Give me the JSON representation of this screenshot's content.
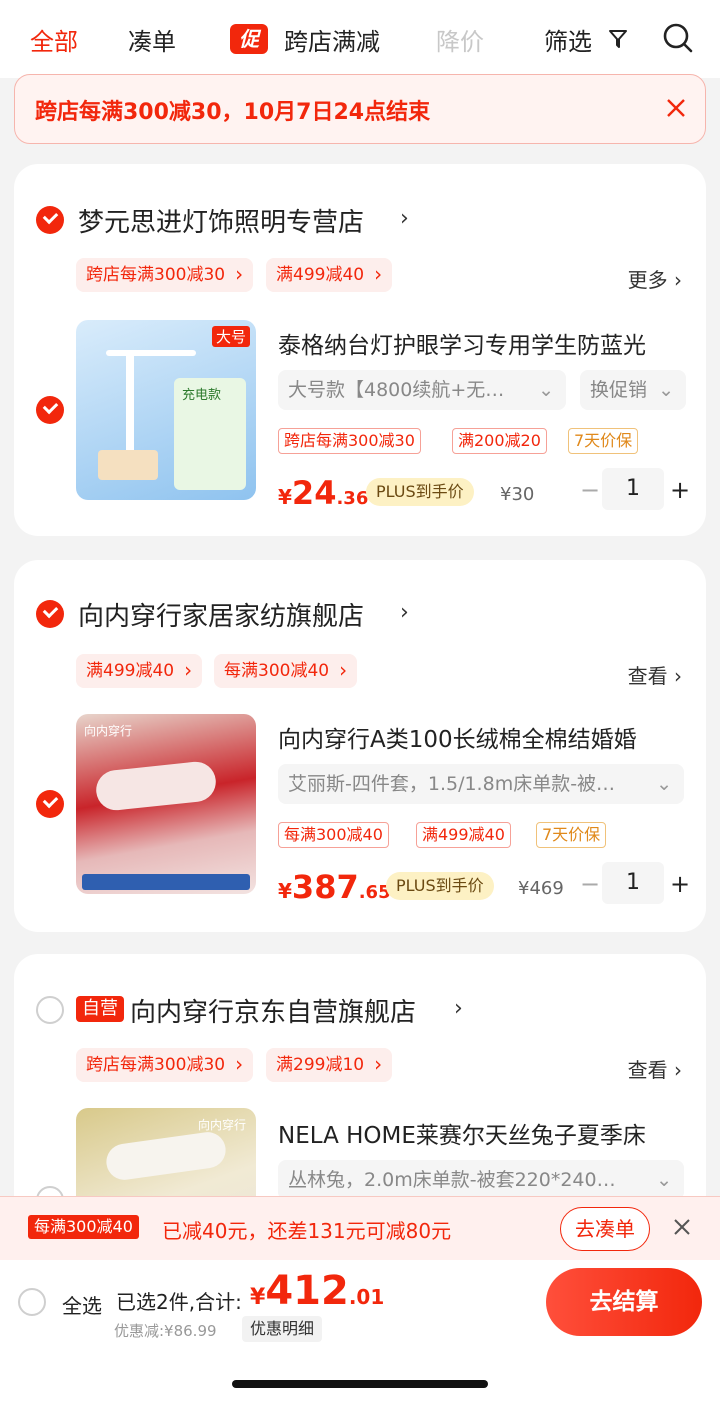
{
  "tabs": [
    {
      "label": "全部"
    },
    {
      "label": "凑单"
    },
    {
      "label": "跨店满减",
      "tag": "促"
    },
    {
      "label": "降价"
    },
    {
      "label": "筛选"
    }
  ],
  "notice": {
    "text": "跨店每满300减30，10月7日24点结束"
  },
  "stores": [
    {
      "name": "梦元思进灯饰照明专营店",
      "promos": [
        "跨店每满300减30",
        "满499减40"
      ],
      "more_label": "更多",
      "product": {
        "title": "泰格纳台灯护眼学习专用学生防蓝光",
        "spec": "大号款【4800续航+无…",
        "spec_extra": "换促销",
        "tags": [
          "跨店每满300减30",
          "满200减20",
          "7天价保"
        ],
        "price_int": "24",
        "price_dec": ".36",
        "plus_label": "PLUS到手价",
        "original_price": "¥30",
        "qty": "1",
        "thumb_label": "大号",
        "thumb_sub": "充电款"
      }
    },
    {
      "name": "向内穿行家居家纺旗舰店",
      "promos": [
        "满499减40",
        "每满300减40"
      ],
      "more_label": "查看",
      "product": {
        "title": "向内穿行A类100长绒棉全棉结婚婚",
        "spec": "艾丽斯-四件套，1.5/1.8m床单款-被…",
        "tags": [
          "每满300减40",
          "满499减40",
          "7天价保"
        ],
        "price_int": "387",
        "price_dec": ".65",
        "plus_label": "PLUS到手价",
        "original_price": "¥469",
        "qty": "1",
        "thumb_label": "向内穿行"
      }
    },
    {
      "name": "向内穿行京东自营旗舰店",
      "self_badge": "自营",
      "promos": [
        "跨店每满300减30",
        "满299减10"
      ],
      "more_label": "查看",
      "product": {
        "title": "NELA HOME莱赛尔天丝兔子夏季床",
        "spec": "丛林兔，2.0m床单款-被套220*240…",
        "thumb_label": "向内穿行"
      }
    }
  ],
  "promo_bar": {
    "badge": "每满300减40",
    "message": "已减40元，还差131元可减80元",
    "action": "去凑单"
  },
  "footer": {
    "select_all": "全选",
    "summary": "已选2件,合计:",
    "total_int": "412",
    "total_dec": ".01",
    "discount": "优惠减:¥86.99",
    "detail": "优惠明细",
    "checkout": "去结算"
  },
  "colors": {
    "accent": "#f2270c",
    "plus_bg": "#fdf1c4"
  }
}
